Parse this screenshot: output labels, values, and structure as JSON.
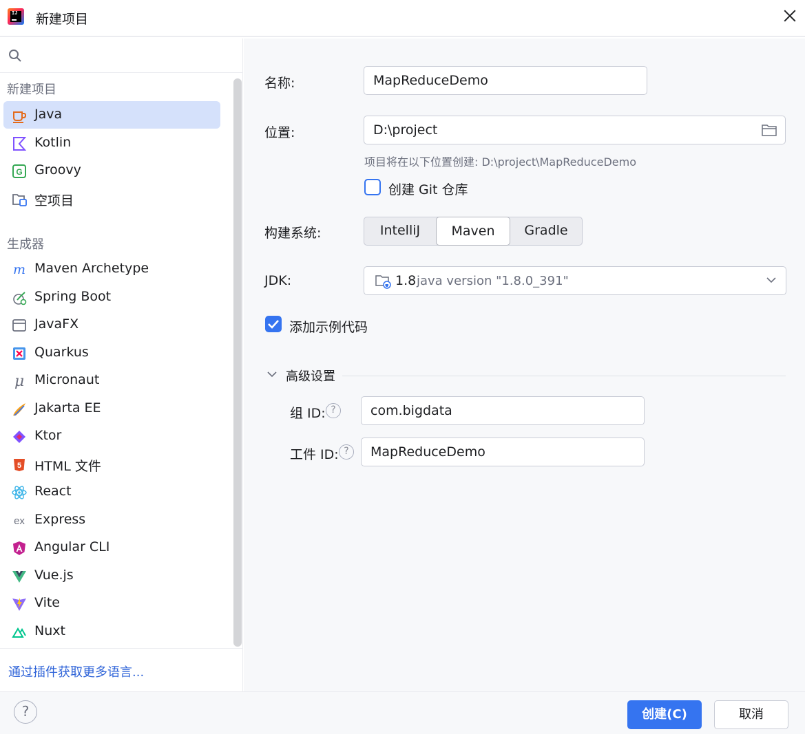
{
  "window": {
    "title": "新建项目",
    "close": "close"
  },
  "sidebar": {
    "search_placeholder": "",
    "groups": [
      {
        "label": "新建项目"
      },
      {
        "label": "生成器"
      }
    ],
    "new_project_items": [
      {
        "label": "Java",
        "icon": "java-cup-icon",
        "selected": true
      },
      {
        "label": "Kotlin",
        "icon": "kotlin-icon"
      },
      {
        "label": "Groovy",
        "icon": "groovy-icon"
      },
      {
        "label": "空项目",
        "icon": "empty-project-icon"
      }
    ],
    "generator_items": [
      {
        "label": "Maven Archetype",
        "icon": "maven-icon"
      },
      {
        "label": "Spring Boot",
        "icon": "spring-boot-icon"
      },
      {
        "label": "JavaFX",
        "icon": "javafx-icon"
      },
      {
        "label": "Quarkus",
        "icon": "quarkus-icon"
      },
      {
        "label": "Micronaut",
        "icon": "micronaut-icon"
      },
      {
        "label": "Jakarta EE",
        "icon": "jakarta-ee-icon"
      },
      {
        "label": "Ktor",
        "icon": "ktor-icon"
      },
      {
        "label": "HTML 文件",
        "icon": "html5-icon"
      },
      {
        "label": "React",
        "icon": "react-icon"
      },
      {
        "label": "Express",
        "icon": "express-icon"
      },
      {
        "label": "Angular CLI",
        "icon": "angular-icon"
      },
      {
        "label": "Vue.js",
        "icon": "vue-icon"
      },
      {
        "label": "Vite",
        "icon": "vite-icon"
      },
      {
        "label": "Nuxt",
        "icon": "nuxt-icon"
      }
    ],
    "plugin_link": "通过插件获取更多语言..."
  },
  "form": {
    "name_label": "名称:",
    "name_value": "MapReduceDemo",
    "location_label": "位置:",
    "location_value": "D:\\project",
    "location_hint": "项目将在以下位置创建: D:\\project\\MapReduceDemo",
    "git_label": "创建 Git 仓库",
    "git_checked": false,
    "build_label": "构建系统:",
    "build_options": [
      "IntelliJ",
      "Maven",
      "Gradle"
    ],
    "build_selected": "Maven",
    "jdk_label": "JDK:",
    "jdk_version": "1.8",
    "jdk_description": "java version \"1.8.0_391\"",
    "sample_code_label": "添加示例代码",
    "sample_code_checked": true,
    "advanced_label": "高级设置",
    "group_id_label": "组 ID:",
    "group_id_value": "com.bigdata",
    "artifact_id_label": "工件 ID:",
    "artifact_id_value": "MapReduceDemo"
  },
  "footer": {
    "help_label": "?",
    "create_label": "创建(C)",
    "cancel_label": "取消"
  },
  "colors": {
    "accent": "#3574f0",
    "selected_row": "#d5e1fb",
    "link": "#2e63d8"
  }
}
